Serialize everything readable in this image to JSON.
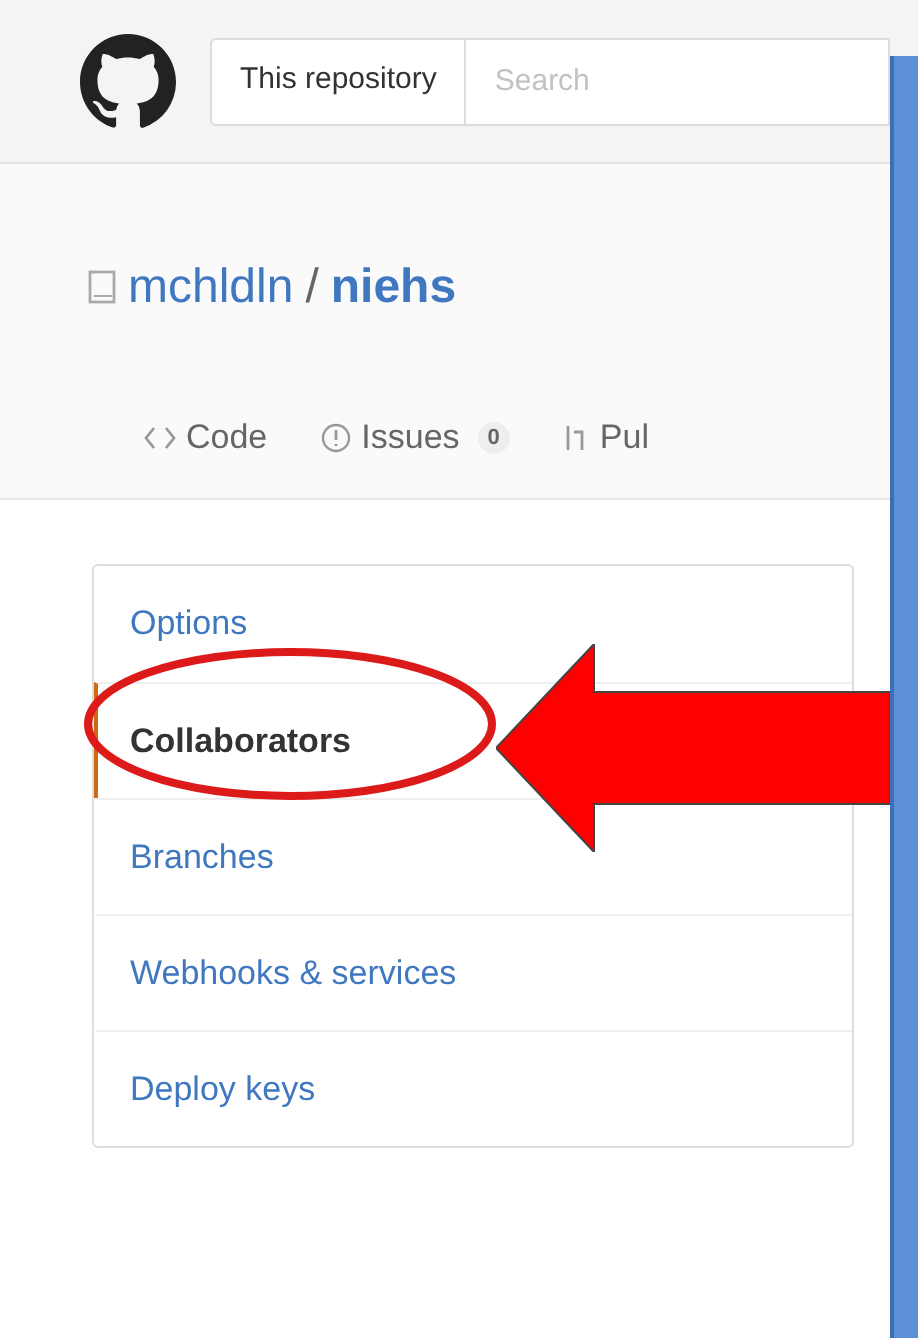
{
  "header": {
    "search": {
      "scope": "This repository",
      "placeholder": "Search"
    }
  },
  "repo": {
    "owner": "mchldln",
    "separator": "/",
    "name": "niehs"
  },
  "tabs": [
    {
      "kind": "code",
      "label": "Code"
    },
    {
      "kind": "issues",
      "label": "Issues",
      "count": "0"
    },
    {
      "kind": "pulls",
      "label": "Pul"
    }
  ],
  "settings_menu": [
    {
      "label": "Options",
      "selected": false
    },
    {
      "label": "Collaborators",
      "selected": true
    },
    {
      "label": "Branches",
      "selected": false
    },
    {
      "label": "Webhooks & services",
      "selected": false
    },
    {
      "label": "Deploy keys",
      "selected": false
    }
  ]
}
